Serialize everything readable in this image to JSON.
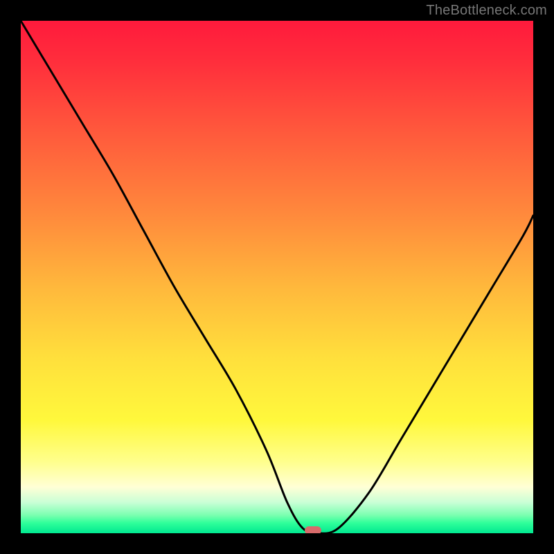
{
  "watermark": "TheBottleneck.com",
  "chart_data": {
    "type": "line",
    "title": "",
    "xlabel": "",
    "ylabel": "",
    "xlim": [
      0,
      100
    ],
    "ylim": [
      0,
      100
    ],
    "series": [
      {
        "name": "bottleneck-curve",
        "x": [
          0,
          6,
          12,
          18,
          24,
          30,
          36,
          42,
          48,
          52,
          55,
          58,
          62,
          68,
          74,
          80,
          86,
          92,
          98,
          100
        ],
        "y": [
          100,
          90,
          80,
          70,
          59,
          48,
          38,
          28,
          16,
          6,
          1,
          0,
          1,
          8,
          18,
          28,
          38,
          48,
          58,
          62
        ]
      }
    ],
    "marker": {
      "x": 57,
      "y": 0.5
    },
    "gradient_stops": [
      {
        "pos": 0,
        "color": "#ff1a3c"
      },
      {
        "pos": 0.08,
        "color": "#ff2e3c"
      },
      {
        "pos": 0.22,
        "color": "#ff5a3c"
      },
      {
        "pos": 0.38,
        "color": "#ff8a3c"
      },
      {
        "pos": 0.52,
        "color": "#ffb83c"
      },
      {
        "pos": 0.66,
        "color": "#ffe03c"
      },
      {
        "pos": 0.78,
        "color": "#fff83c"
      },
      {
        "pos": 0.86,
        "color": "#ffff8c"
      },
      {
        "pos": 0.91,
        "color": "#ffffd6"
      },
      {
        "pos": 0.94,
        "color": "#c9ffd6"
      },
      {
        "pos": 0.965,
        "color": "#7affb0"
      },
      {
        "pos": 0.98,
        "color": "#2fff9a"
      },
      {
        "pos": 1.0,
        "color": "#00e890"
      }
    ]
  }
}
